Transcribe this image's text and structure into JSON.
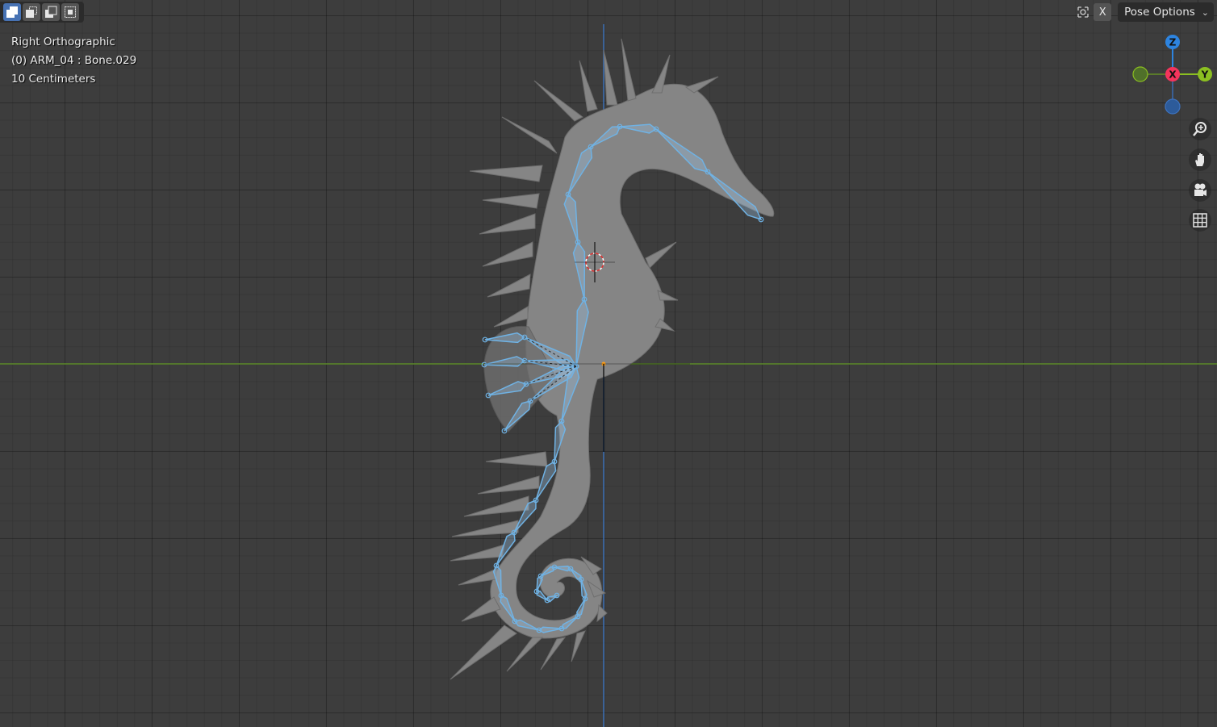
{
  "viewport": {
    "overlay": {
      "view_name": "Right Orthographic",
      "active_object": "(0) ARM_04 : Bone.029",
      "grid_scale": "10 Centimeters"
    }
  },
  "toolbar": {
    "modes": [
      {
        "icon": "select-new-icon",
        "active": true
      },
      {
        "icon": "select-extend-icon",
        "active": false
      },
      {
        "icon": "select-subtract-icon",
        "active": false
      },
      {
        "icon": "select-intersect-icon",
        "active": false
      }
    ]
  },
  "header_right": {
    "mirror_icon": "mirror-icon",
    "x_toggle_label": "X",
    "pose_options_label": "Pose Options"
  },
  "gizmo": {
    "z_label": "Z",
    "x_label": "X",
    "y_label": "Y",
    "colors": {
      "x": "#f4345c",
      "y": "#8bbf21",
      "z": "#2d84e0"
    }
  },
  "navigation": [
    "zoom-icon",
    "pan-hand-icon",
    "camera-icon",
    "grid-toggle-icon"
  ],
  "colors": {
    "background": "#3d3d3d",
    "mesh": "#858585",
    "bones": "#8bb8dc",
    "y_axis_line": "#5d8a2a",
    "z_axis_line": "#3b6fb3"
  }
}
